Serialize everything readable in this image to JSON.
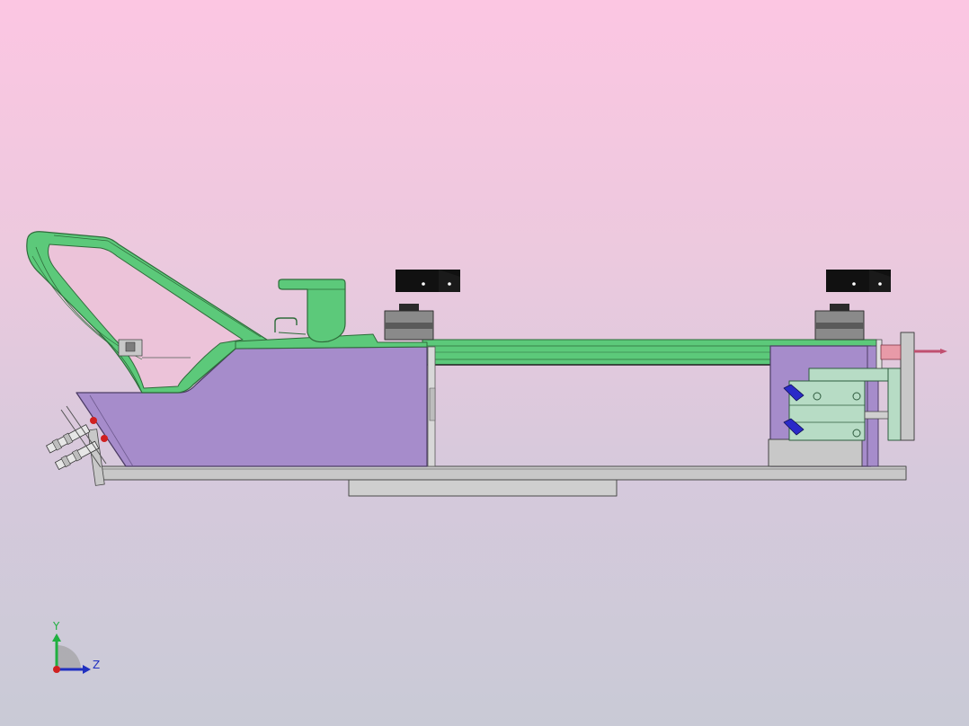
{
  "viewport": {
    "background_top": "#fcc6e2",
    "background_bottom": "#c9cad6"
  },
  "model": {
    "colors": {
      "green_part": "#5cc97a",
      "green_dark": "#2e8a45",
      "purple_plate": "#a68ccb",
      "purple_edge": "#5d4a78",
      "base_plate": "#c8c8c8",
      "base_edge": "#4a4a4a",
      "motor_body": "#8a8a8a",
      "motor_cap": "#2b2b2b",
      "bracket_black": "#111111",
      "mint_block": "#b7dcc5",
      "blue_fitting": "#2a2ac8",
      "red_marker": "#d02020",
      "pink_pin": "#e89aa8"
    }
  },
  "triad": {
    "y_label": "Y",
    "z_label": "Z",
    "y_color": "#20b040",
    "z_color": "#2030c0",
    "x_color": "#d02020"
  }
}
